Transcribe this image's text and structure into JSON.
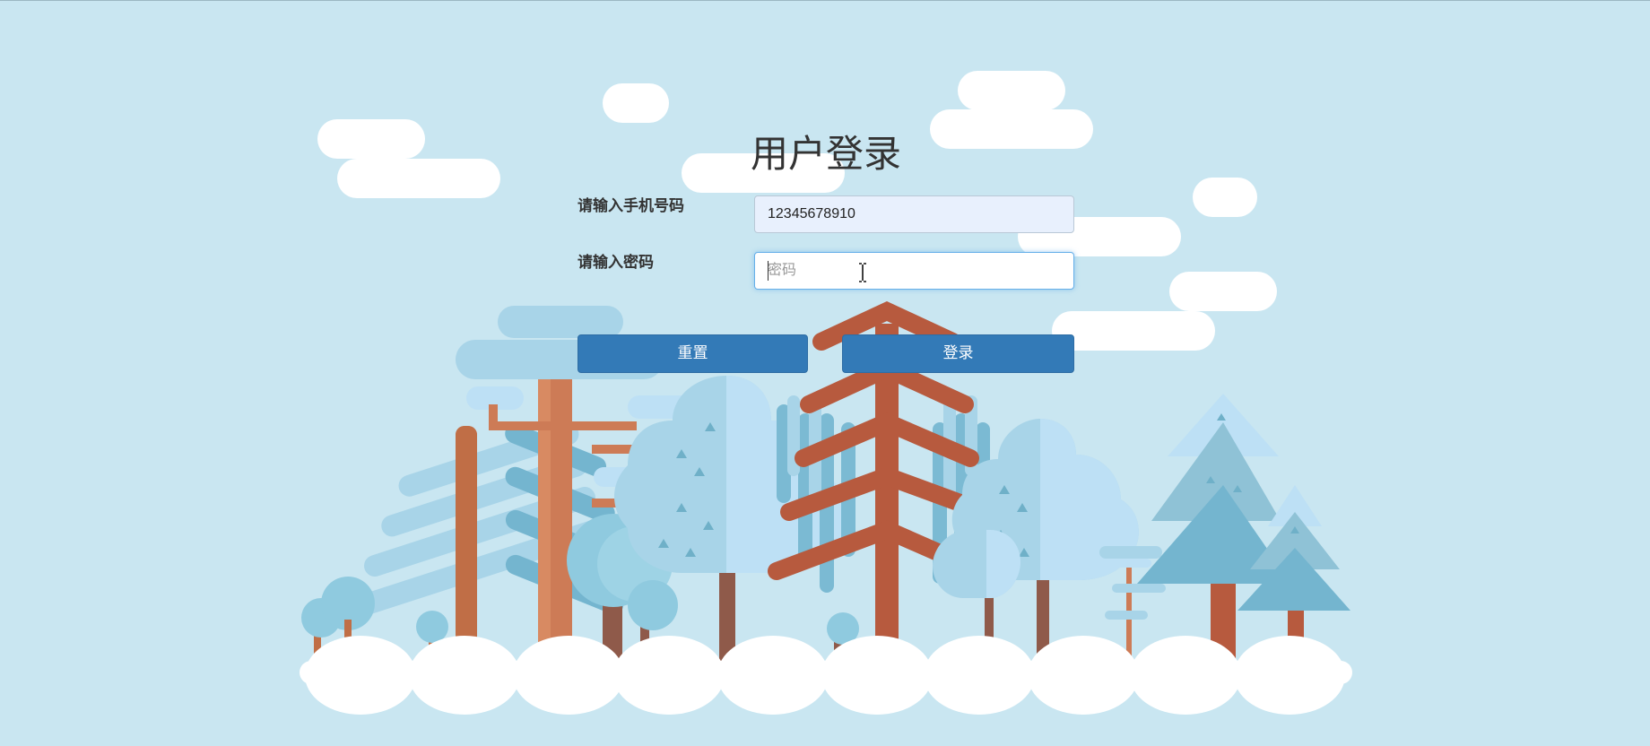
{
  "login": {
    "title": "用户登录",
    "phone_label": "请输入手机号码",
    "phone_value": "12345678910",
    "password_label": "请输入密码",
    "password_placeholder": "密码",
    "reset_label": "重置",
    "login_label": "登录"
  },
  "colors": {
    "background": "#c9e6f1",
    "button": "#337ab7",
    "tree_red": "#b75a3e",
    "tree_orange": "#cd7b56",
    "tree_blue_light": "#bde0f5",
    "tree_blue": "#a8d4e8",
    "tree_blue_dark": "#74b5cf",
    "cloud": "#ffffff"
  },
  "icons": [
    "text-cursor-icon"
  ]
}
